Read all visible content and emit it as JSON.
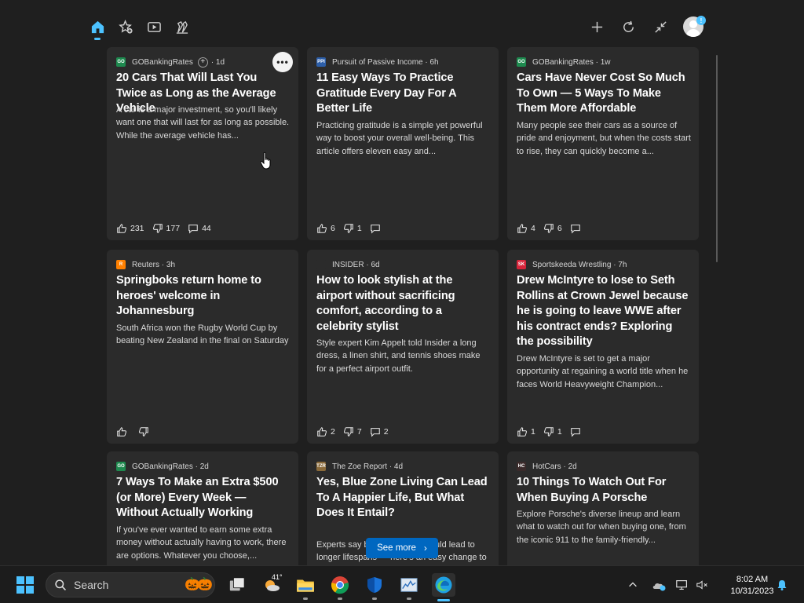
{
  "topbar": {
    "icons": [
      "home-icon",
      "star-add-icon",
      "video-icon",
      "games-icon",
      "plus-icon",
      "refresh-icon",
      "collapse-icon",
      "avatar"
    ],
    "avatar_badge": "!"
  },
  "cards": [
    {
      "source": "GOBankingRates",
      "time": "1d",
      "logo_text": "GO",
      "logo_color": "#1e8a4f",
      "title": "20 Cars That Will Last You Twice as Long as the Average Vehicle",
      "snippet": "A car is a major investment, so you'll likely want one that will last for as long as possible. While the average vehicle has...",
      "likes": "231",
      "dislikes": "177",
      "comments": "44"
    },
    {
      "source": "Pursuit of Passive Income",
      "time": "6h",
      "logo_text": "PPI",
      "logo_color": "#2c5ea8",
      "title": "11 Easy Ways To Practice Gratitude Every Day For A Better Life",
      "snippet": "Practicing gratitude is a simple yet powerful way to boost your overall well-being. This article offers eleven easy and...",
      "likes": "6",
      "dislikes": "1",
      "comments": ""
    },
    {
      "source": "GOBankingRates",
      "time": "1w",
      "logo_text": "GO",
      "logo_color": "#1e8a4f",
      "title": "Cars Have Never Cost So Much To Own — 5 Ways To Make Them More Affordable",
      "snippet": "Many people see their cars as a source of pride and enjoyment, but when the costs start to rise, they can quickly become a...",
      "likes": "4",
      "dislikes": "6",
      "comments": ""
    },
    {
      "source": "Reuters",
      "time": "3h",
      "logo_text": "R",
      "logo_color": "#ff8000",
      "title": "Springboks return home to heroes' welcome in Johannesburg",
      "snippet": "South Africa won the Rugby World Cup by beating New Zealand in the final on Saturday",
      "likes": "",
      "dislikes": "",
      "comments": ""
    },
    {
      "source": "INSIDER",
      "time": "6d",
      "logo_text": "",
      "logo_color": "#2b2b2b",
      "title": "How to look stylish at the airport without sacrificing comfort, according to a celebrity stylist",
      "snippet": "Style expert Kim Appelt told Insider a long dress, a linen shirt, and tennis shoes make for a perfect airport outfit.",
      "likes": "2",
      "dislikes": "7",
      "comments": "2"
    },
    {
      "source": "Sportskeeda Wrestling",
      "time": "7h",
      "logo_text": "SK",
      "logo_color": "#d6243a",
      "title": "Drew McIntyre to lose to Seth Rollins at Crown Jewel because he is going to leave WWE after his contract ends? Exploring the possibility",
      "snippet": "Drew McIntyre is set to get a major opportunity at regaining a world title when he faces World Heavyweight Champion...",
      "likes": "1",
      "dislikes": "1",
      "comments": ""
    },
    {
      "source": "GOBankingRates",
      "time": "2d",
      "logo_text": "GO",
      "logo_color": "#1e8a4f",
      "title": "7 Ways To Make an Extra $500 (or More) Every Week — Without Actually Working",
      "snippet": "If you've ever wanted to earn some extra money without actually having to work, there are options. Whatever you choose,...",
      "likes": "",
      "dislikes": "",
      "comments": ""
    },
    {
      "source": "The Zoe Report",
      "time": "4d",
      "logo_text": "TZR",
      "logo_color": "#8a6a3a",
      "title": "Yes, Blue Zone Living Can Lead To A Happier Life, But What Does It Entail?",
      "snippet": "Experts say blue zone living could lead to longer lifespans — here's an easy change to make.",
      "likes": "",
      "dislikes": "",
      "comments": ""
    },
    {
      "source": "HotCars",
      "time": "2d",
      "logo_text": "HC",
      "logo_color": "#3a2a2a",
      "title": "10 Things To Watch Out For When Buying A Porsche",
      "snippet": "Explore Porsche's diverse lineup and learn what to watch out for when buying one, from the iconic 911 to the family-friendly...",
      "likes": "",
      "dislikes": "",
      "comments": ""
    }
  ],
  "card_menu": "•••",
  "follow_symbol": "+",
  "see_more": {
    "label": "See more",
    "chevron": "›"
  },
  "taskbar": {
    "search_placeholder": "Search",
    "weather_temp": "41°",
    "time": "8:02 AM",
    "date": "10/31/2023",
    "apps": [
      "start",
      "search",
      "task-view",
      "weather",
      "file-explorer",
      "chrome",
      "defender",
      "stock-app",
      "edge"
    ]
  },
  "colors": {
    "accent": "#4cc2ff",
    "card_bg": "#2b2b2b",
    "page_bg": "#1f1f1f",
    "see_more_bg": "#0067c0"
  }
}
